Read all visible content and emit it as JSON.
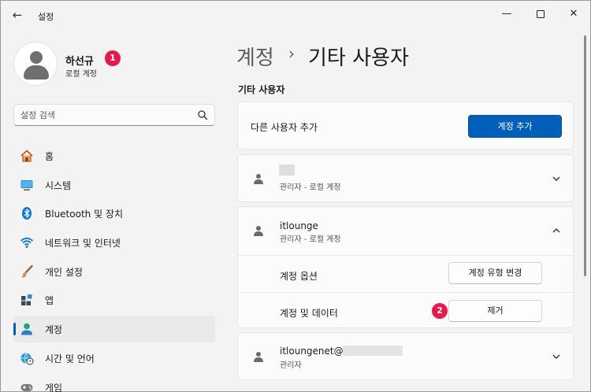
{
  "window": {
    "title": "설정",
    "icons": {
      "back": "arrow-left-icon",
      "minimize": "minimize-icon",
      "maximize": "maximize-icon",
      "close": "close-icon"
    }
  },
  "profile": {
    "name": "하선규",
    "account_type": "로컬 계정",
    "badge": "1"
  },
  "search": {
    "placeholder": "설정 검색"
  },
  "sidebar": {
    "items": [
      {
        "label": "홈",
        "icon": "home-icon"
      },
      {
        "label": "시스템",
        "icon": "system-icon"
      },
      {
        "label": "Bluetooth 및 장치",
        "icon": "bluetooth-icon"
      },
      {
        "label": "네트워크 및 인터넷",
        "icon": "wifi-icon"
      },
      {
        "label": "개인 설정",
        "icon": "brush-icon"
      },
      {
        "label": "앱",
        "icon": "apps-icon"
      },
      {
        "label": "계정",
        "icon": "accounts-icon",
        "active": true
      },
      {
        "label": "시간 및 언어",
        "icon": "globe-clock-icon"
      },
      {
        "label": "게임",
        "icon": "game-icon"
      }
    ]
  },
  "breadcrumb": {
    "parent": "계정",
    "separator": "›",
    "current": "기타 사용자"
  },
  "section": {
    "title": "기타 사용자"
  },
  "add_user": {
    "label": "다른 사용자 추가",
    "button": "계정 추가"
  },
  "users": [
    {
      "name": "",
      "role": "관리자 - 로컬 계정",
      "expanded": false
    },
    {
      "name": "itlounge",
      "role": "관리자 - 로컬 계정",
      "expanded": true,
      "options": [
        {
          "label": "계정 옵션",
          "button": "계정 유형 변경"
        },
        {
          "label": "계정 및 데이터",
          "button": "제거",
          "badge": "2"
        }
      ]
    },
    {
      "name": "itloungenet@",
      "role": "관리자",
      "expanded": false
    }
  ],
  "colors": {
    "accent": "#005fb8",
    "badge": "#e8174d",
    "background": "#f3f3f3",
    "card": "#fbfbfb"
  }
}
